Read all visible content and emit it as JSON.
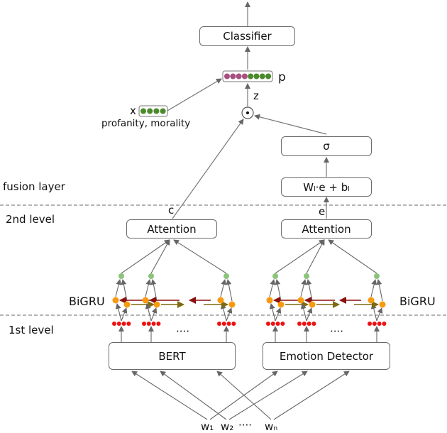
{
  "title": "Architecture diagram: BERT + Emotion Detector with BiGRU attention and fusion layer",
  "layers": {
    "fusion": "fusion layer",
    "second": "2nd level",
    "first": "1st level"
  },
  "nodes": {
    "classifier": "Classifier",
    "sigma": "σ",
    "linear": "Wₗ·e + bₗ",
    "attention_left": "Attention",
    "attention_right": "Attention",
    "bert": "BERT",
    "emotion": "Emotion Detector",
    "bigru_left": "BiGRU",
    "bigru_right": "BiGRU"
  },
  "vectors": {
    "p": "p",
    "z": "z",
    "x": "x",
    "x_desc": "profanity, morality",
    "c": "c",
    "e": "e",
    "hadamard": "⊙"
  },
  "inputs": {
    "w1": "w₁",
    "w2": "w₂",
    "dots": "····",
    "wn": "wₙ"
  },
  "ellipsis": "····",
  "colors": {
    "p_left": "#a8507f",
    "p_right": "#4a8a2a",
    "x": "#4a8a2a",
    "token_emb": "#ee1111",
    "gru_state": "#f79a10",
    "attn_node": "#8cc47a",
    "backward_arrow": "#8b1010",
    "forward_arrow": "#7f6a10",
    "edge": "#666666"
  }
}
